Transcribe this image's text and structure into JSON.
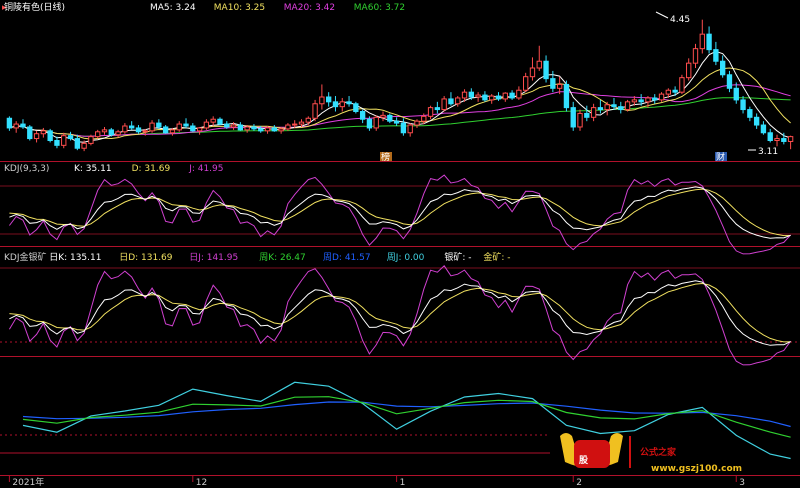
{
  "colors": {
    "background": "#000000",
    "up": "#ff4d4d",
    "down": "#33e0ff",
    "divider": "#b0112b",
    "ma5": "#ffffff",
    "ma10": "#f0e060",
    "ma20": "#e040e0",
    "ma60": "#30d030",
    "kdj_k": "#ffffff",
    "kdj_d": "#f0e060",
    "kdj_j": "#d040d0",
    "weekly_k": "#30d030",
    "weekly_d": "#2060ff",
    "weekly_j": "#40d0e0",
    "watermark_red": "#d01010",
    "watermark_gold": "#f0c020"
  },
  "panels": {
    "main": {
      "title": "铜陵有色(日线)",
      "legend": [
        {
          "label": "MA5: 3.24",
          "color": "#ffffff"
        },
        {
          "label": "MA10: 3.25",
          "color": "#f0e060"
        },
        {
          "label": "MA20: 3.42",
          "color": "#e040e0"
        },
        {
          "label": "MA60: 3.72",
          "color": "#30d030"
        }
      ],
      "high_label": "4.45",
      "low_label": "3.11",
      "markers": [
        {
          "text": "榜"
        },
        {
          "text": "财"
        }
      ]
    },
    "kdj": {
      "legend": [
        {
          "label": "KDJ(9,3,3)",
          "color": "#cccccc"
        },
        {
          "label": "K: 35.11",
          "color": "#ffffff"
        },
        {
          "label": "D: 31.69",
          "color": "#f0e060"
        },
        {
          "label": "J: 41.95",
          "color": "#d040d0"
        }
      ]
    },
    "kdj_gold": {
      "legend": [
        {
          "label": "KDJ金银矿",
          "color": "#cccccc"
        },
        {
          "label": "日K: 135.11",
          "color": "#ffffff"
        },
        {
          "label": "日D: 131.69",
          "color": "#f0e060"
        },
        {
          "label": "日J: 141.95",
          "color": "#d040d0"
        },
        {
          "label": "周K: 26.47",
          "color": "#30d030"
        },
        {
          "label": "周D: 41.57",
          "color": "#2060ff"
        },
        {
          "label": "周J: 0.00",
          "color": "#40d0e0"
        },
        {
          "label": "银矿: -",
          "color": "#ffffff"
        },
        {
          "label": "金矿: -",
          "color": "#f0e060"
        }
      ]
    }
  },
  "x_axis": {
    "labels": [
      {
        "text": "2021年",
        "i": 0
      },
      {
        "text": "12",
        "i": 27
      },
      {
        "text": "1",
        "i": 57
      },
      {
        "text": "2",
        "i": 83
      },
      {
        "text": "3",
        "i": 107
      }
    ]
  },
  "watermark": {
    "badge": "股",
    "title": "公式之家",
    "url": "www.gszj100.com"
  },
  "chart_data": {
    "type": "candlestick",
    "ohlc": [
      [
        3.43,
        3.45,
        3.3,
        3.33
      ],
      [
        3.33,
        3.4,
        3.28,
        3.37
      ],
      [
        3.37,
        3.42,
        3.32,
        3.34
      ],
      [
        3.34,
        3.36,
        3.2,
        3.22
      ],
      [
        3.22,
        3.3,
        3.18,
        3.27
      ],
      [
        3.27,
        3.33,
        3.23,
        3.3
      ],
      [
        3.3,
        3.32,
        3.18,
        3.2
      ],
      [
        3.2,
        3.24,
        3.12,
        3.15
      ],
      [
        3.15,
        3.28,
        3.12,
        3.25
      ],
      [
        3.25,
        3.29,
        3.2,
        3.22
      ],
      [
        3.22,
        3.26,
        3.1,
        3.12
      ],
      [
        3.12,
        3.2,
        3.09,
        3.17
      ],
      [
        3.17,
        3.26,
        3.15,
        3.24
      ],
      [
        3.24,
        3.31,
        3.22,
        3.29
      ],
      [
        3.29,
        3.34,
        3.26,
        3.31
      ],
      [
        3.31,
        3.33,
        3.24,
        3.26
      ],
      [
        3.26,
        3.31,
        3.23,
        3.29
      ],
      [
        3.29,
        3.38,
        3.27,
        3.35
      ],
      [
        3.35,
        3.4,
        3.31,
        3.33
      ],
      [
        3.33,
        3.36,
        3.27,
        3.29
      ],
      [
        3.29,
        3.32,
        3.25,
        3.3
      ],
      [
        3.3,
        3.41,
        3.28,
        3.38
      ],
      [
        3.38,
        3.42,
        3.32,
        3.34
      ],
      [
        3.34,
        3.36,
        3.27,
        3.28
      ],
      [
        3.28,
        3.33,
        3.25,
        3.31
      ],
      [
        3.31,
        3.4,
        3.29,
        3.37
      ],
      [
        3.37,
        3.43,
        3.33,
        3.35
      ],
      [
        3.35,
        3.38,
        3.29,
        3.3
      ],
      [
        3.3,
        3.34,
        3.26,
        3.33
      ],
      [
        3.33,
        3.42,
        3.31,
        3.39
      ],
      [
        3.39,
        3.45,
        3.35,
        3.42
      ],
      [
        3.42,
        3.44,
        3.36,
        3.37
      ],
      [
        3.37,
        3.4,
        3.32,
        3.34
      ],
      [
        3.34,
        3.39,
        3.31,
        3.36
      ],
      [
        3.36,
        3.39,
        3.3,
        3.31
      ],
      [
        3.31,
        3.36,
        3.28,
        3.34
      ],
      [
        3.34,
        3.37,
        3.3,
        3.32
      ],
      [
        3.32,
        3.35,
        3.28,
        3.3
      ],
      [
        3.3,
        3.35,
        3.27,
        3.33
      ],
      [
        3.33,
        3.36,
        3.29,
        3.3
      ],
      [
        3.3,
        3.34,
        3.27,
        3.32
      ],
      [
        3.32,
        3.38,
        3.3,
        3.36
      ],
      [
        3.36,
        3.41,
        3.33,
        3.37
      ],
      [
        3.37,
        3.42,
        3.34,
        3.39
      ],
      [
        3.39,
        3.45,
        3.36,
        3.43
      ],
      [
        3.43,
        3.62,
        3.4,
        3.58
      ],
      [
        3.58,
        3.78,
        3.52,
        3.65
      ],
      [
        3.65,
        3.7,
        3.55,
        3.6
      ],
      [
        3.6,
        3.66,
        3.5,
        3.55
      ],
      [
        3.55,
        3.64,
        3.5,
        3.6
      ],
      [
        3.6,
        3.66,
        3.55,
        3.58
      ],
      [
        3.58,
        3.6,
        3.48,
        3.5
      ],
      [
        3.5,
        3.52,
        3.38,
        3.42
      ],
      [
        3.42,
        3.45,
        3.3,
        3.33
      ],
      [
        3.33,
        3.46,
        3.3,
        3.44
      ],
      [
        3.44,
        3.5,
        3.4,
        3.46
      ],
      [
        3.46,
        3.48,
        3.38,
        3.4
      ],
      [
        3.4,
        3.44,
        3.35,
        3.38
      ],
      [
        3.38,
        3.43,
        3.25,
        3.28
      ],
      [
        3.28,
        3.38,
        3.24,
        3.36
      ],
      [
        3.36,
        3.42,
        3.33,
        3.4
      ],
      [
        3.4,
        3.48,
        3.37,
        3.45
      ],
      [
        3.45,
        3.56,
        3.42,
        3.54
      ],
      [
        3.54,
        3.6,
        3.48,
        3.52
      ],
      [
        3.52,
        3.66,
        3.5,
        3.63
      ],
      [
        3.63,
        3.7,
        3.56,
        3.58
      ],
      [
        3.58,
        3.66,
        3.55,
        3.64
      ],
      [
        3.64,
        3.73,
        3.6,
        3.7
      ],
      [
        3.7,
        3.74,
        3.62,
        3.65
      ],
      [
        3.65,
        3.7,
        3.6,
        3.67
      ],
      [
        3.67,
        3.71,
        3.6,
        3.62
      ],
      [
        3.62,
        3.68,
        3.58,
        3.66
      ],
      [
        3.66,
        3.7,
        3.61,
        3.63
      ],
      [
        3.63,
        3.7,
        3.6,
        3.69
      ],
      [
        3.69,
        3.72,
        3.62,
        3.64
      ],
      [
        3.64,
        3.76,
        3.62,
        3.72
      ],
      [
        3.72,
        3.9,
        3.7,
        3.86
      ],
      [
        3.86,
        4.06,
        3.82,
        3.95
      ],
      [
        3.95,
        4.18,
        3.92,
        4.02
      ],
      [
        4.02,
        4.08,
        3.8,
        3.84
      ],
      [
        3.84,
        3.92,
        3.7,
        3.74
      ],
      [
        3.74,
        3.86,
        3.68,
        3.78
      ],
      [
        3.78,
        3.82,
        3.5,
        3.54
      ],
      [
        3.54,
        3.6,
        3.3,
        3.34
      ],
      [
        3.34,
        3.52,
        3.3,
        3.48
      ],
      [
        3.48,
        3.56,
        3.4,
        3.44
      ],
      [
        3.44,
        3.58,
        3.4,
        3.54
      ],
      [
        3.54,
        3.62,
        3.48,
        3.52
      ],
      [
        3.52,
        3.6,
        3.46,
        3.57
      ],
      [
        3.57,
        3.64,
        3.52,
        3.55
      ],
      [
        3.55,
        3.6,
        3.48,
        3.52
      ],
      [
        3.52,
        3.62,
        3.5,
        3.6
      ],
      [
        3.6,
        3.66,
        3.56,
        3.62
      ],
      [
        3.62,
        3.68,
        3.56,
        3.6
      ],
      [
        3.6,
        3.66,
        3.54,
        3.64
      ],
      [
        3.64,
        3.68,
        3.58,
        3.62
      ],
      [
        3.62,
        3.7,
        3.6,
        3.68
      ],
      [
        3.68,
        3.74,
        3.64,
        3.72
      ],
      [
        3.72,
        3.76,
        3.66,
        3.7
      ],
      [
        3.7,
        3.88,
        3.68,
        3.85
      ],
      [
        3.85,
        4.05,
        3.82,
        4.0
      ],
      [
        4.0,
        4.2,
        3.95,
        4.15
      ],
      [
        4.15,
        4.45,
        4.1,
        4.3
      ],
      [
        4.3,
        4.38,
        4.1,
        4.14
      ],
      [
        4.14,
        4.22,
        3.98,
        4.02
      ],
      [
        4.02,
        4.08,
        3.85,
        3.88
      ],
      [
        3.88,
        3.92,
        3.7,
        3.74
      ],
      [
        3.74,
        3.8,
        3.58,
        3.62
      ],
      [
        3.62,
        3.66,
        3.48,
        3.52
      ],
      [
        3.52,
        3.55,
        3.4,
        3.44
      ],
      [
        3.44,
        3.48,
        3.32,
        3.36
      ],
      [
        3.36,
        3.4,
        3.26,
        3.28
      ],
      [
        3.28,
        3.32,
        3.18,
        3.2
      ],
      [
        3.2,
        3.26,
        3.14,
        3.22
      ],
      [
        3.22,
        3.28,
        3.16,
        3.19
      ],
      [
        3.19,
        3.25,
        3.11,
        3.24
      ]
    ],
    "ylim": [
      3.05,
      4.55
    ]
  }
}
